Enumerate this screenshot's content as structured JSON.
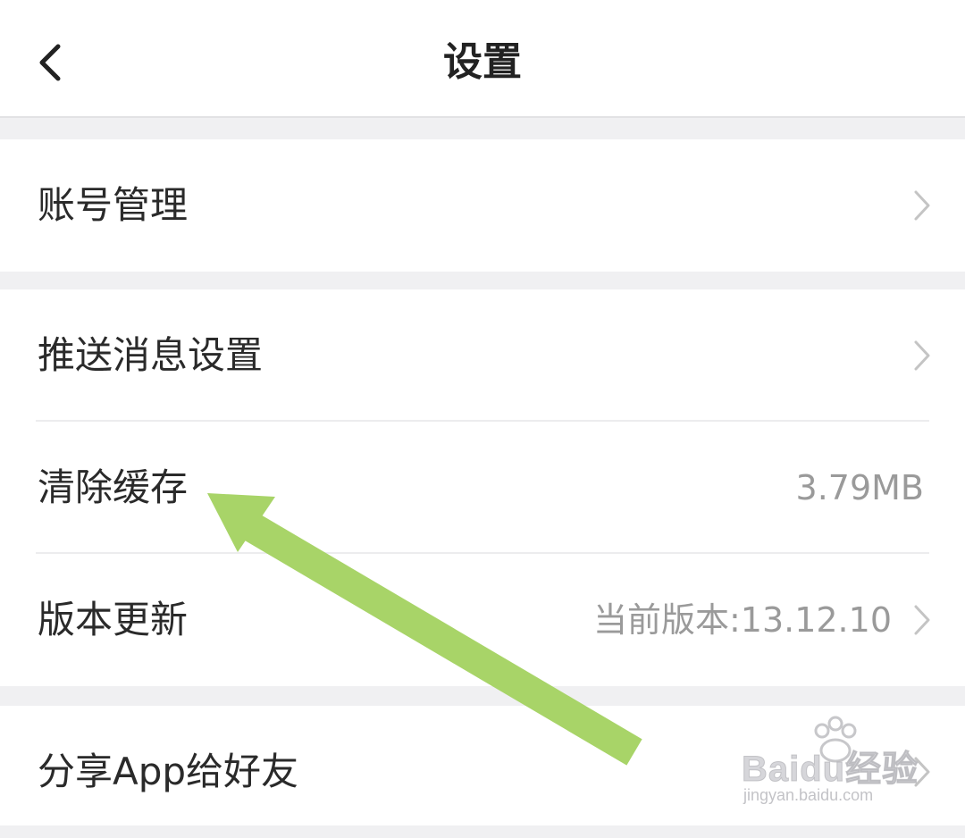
{
  "header": {
    "title": "设置",
    "back_icon": "chevron-left-icon"
  },
  "sections": [
    {
      "items": [
        {
          "label": "账号管理",
          "value": "",
          "chevron": true
        }
      ]
    },
    {
      "items": [
        {
          "label": "推送消息设置",
          "value": "",
          "chevron": true
        },
        {
          "label": "清除缓存",
          "value": "3.79MB",
          "chevron": false
        },
        {
          "label": "版本更新",
          "value": "当前版本:13.12.10",
          "chevron": true
        }
      ]
    },
    {
      "items": [
        {
          "label": "分享App给好友",
          "value": "",
          "chevron": true
        }
      ]
    }
  ],
  "annotation": {
    "arrow_color": "#a8d468",
    "points_to": "清除缓存"
  },
  "watermark": {
    "brand": "Baidu经验",
    "url": "jingyan.baidu.com"
  },
  "colors": {
    "background": "#f0f0f2",
    "row_bg": "#ffffff",
    "label": "#2a2a2a",
    "value": "#9a9a9a",
    "chevron": "#c4c4c4"
  }
}
